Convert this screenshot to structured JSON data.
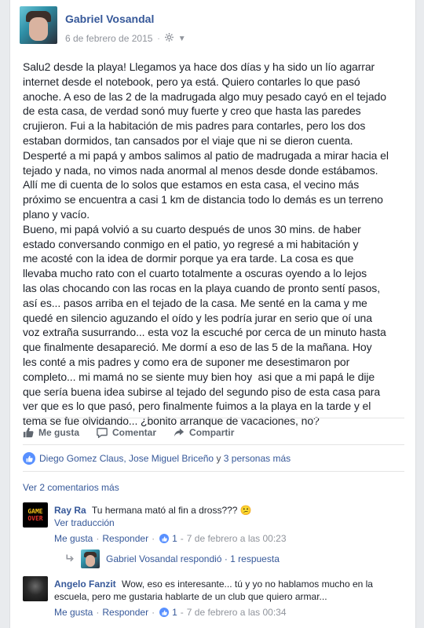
{
  "post": {
    "author": "Gabriel Vosandal",
    "date": "6 de febrero de 2015",
    "privacy_icon": "gear-icon",
    "text": "Salu2 desde la playa! Llegamos ya hace dos días y ha sido un lío agarrar\ninternet desde el notebook, pero ya está. Quiero contarles lo que pasó\nanoche. A eso de las 2 de la madrugada algo muy pesado cayó en el tejado\nde esta casa, de verdad sonó muy fuerte y creo que hasta las paredes\ncrujieron. Fui a la habitación de mis padres para contarles, pero los dos\nestaban dormidos, tan cansados por el viaje que ni se dieron cuenta.\nDesperté a mi papá y ambos salimos al patio de madrugada a mirar hacia el\ntejado y nada, no vimos nada anormal al menos desde donde estábamos.\nAllí me di cuenta de lo solos que estamos en esta casa, el vecino más\npróximo se encuentra a casi 1 km de distancia todo lo demás es un terreno\nplano y vacío.\nBueno, mi papá volvió a su cuarto después de unos 30 mins. de haber\nestado conversando conmigo en el patio, yo regresé a mi habitación y\nme acosté con la idea de dormir porque ya era tarde. La cosa es que\nllevaba mucho rato con el cuarto totalmente a oscuras oyendo a lo lejos\nlas olas chocando con las rocas en la playa cuando de pronto sentí pasos,\nasí es... pasos arriba en el tejado de la casa. Me senté en la cama y me\nquedé en silencio aguzando el oído y les podría jurar en serio que oí una\nvoz extraña susurrando... esta voz la escuché por cerca de un minuto hasta\nque finalmente desapareció. Me dormí a eso de las 5 de la mañana. Hoy\nles conté a mis padres y como era de suponer me desestimaron por\ncompleto... mi mamá no se siente muy bien hoy  asi que a mi papá le dije\nque sería buena idea subirse al tejado del segundo piso de esta casa para\nver que es lo que pasó, pero finalmente fuimos a la playa en la tarde y el\ntema se fue olvidando... ¿bonito arranque de vacaciones, no?"
  },
  "actions": {
    "like": "Me gusta",
    "comment": "Comentar",
    "share": "Compartir"
  },
  "reactions": {
    "names": "Diego Gomez Claus, Jose Miguel Briceño",
    "connector": " y ",
    "others": "3 personas más"
  },
  "view_more_comments": "Ver 2 comentarios más",
  "comments": [
    {
      "name": "Ray Ra",
      "text": "Tu hermana mató al fin a dross???",
      "emoji": "😕",
      "avatar_line1": "GAME",
      "avatar_line2": "OVER",
      "translate": "Ver traducción",
      "like": "Me gusta",
      "reply": "Responder",
      "like_count": "1",
      "timestamp": "7 de febrero a las 00:23"
    },
    {
      "name": "Angelo Fanzit",
      "text": "Wow, eso es interesante... tú y yo no hablamos mucho en la escuela, pero me gustaria hablarte de un club que quiero armar...",
      "like": "Me gusta",
      "reply": "Responder",
      "like_count": "1",
      "timestamp": "7 de febrero a las 00:34"
    }
  ],
  "reply_summary": {
    "name": "Gabriel Vosandal",
    "text": "respondió",
    "count": "1 respuesta"
  },
  "colors": {
    "link": "#365899",
    "like_blue": "#5890ff",
    "muted": "#90949c"
  }
}
